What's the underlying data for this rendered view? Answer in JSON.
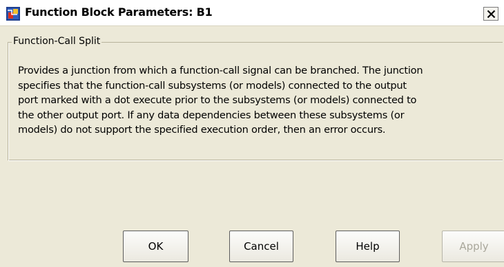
{
  "window": {
    "title": "Function Block Parameters: B1",
    "close_glyph": "✕",
    "icon": "simulink-block-icon"
  },
  "panel": {
    "legend": "Function-Call Split",
    "description": "Provides a junction from which a function-call signal can be branched. The junction\nspecifies that the function-call subsystems (or models) connected to the output\nport marked with a dot execute prior to the subsystems (or models) connected to\nthe other output port. If any data dependencies between these subsystems (or\nmodels) do not support the specified execution order, then an error occurs."
  },
  "buttons": {
    "ok": "OK",
    "cancel": "Cancel",
    "help": "Help",
    "apply": "Apply"
  },
  "colors": {
    "dialog_bg": "#ece9d8",
    "disabled_text": "#a9a79b"
  }
}
